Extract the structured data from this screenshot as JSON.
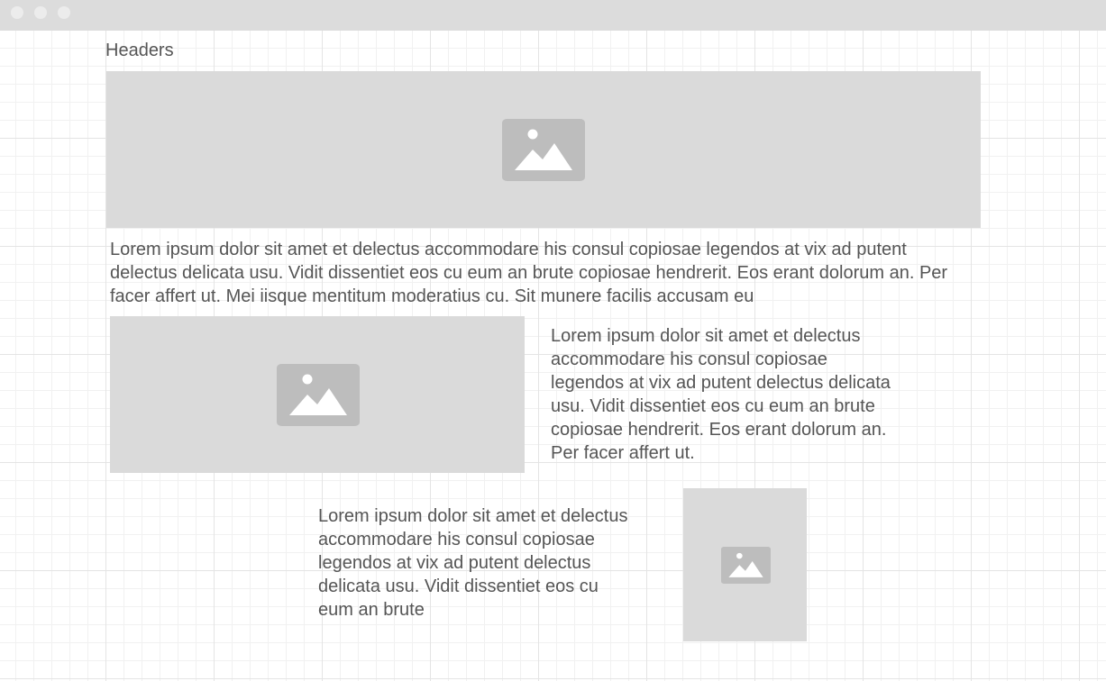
{
  "window": {
    "controls": [
      "close-dot",
      "minimize-dot",
      "maximize-dot"
    ]
  },
  "page": {
    "header": "Headers",
    "hero_image_icon": "image-placeholder-icon",
    "paragraph_1": "Lorem ipsum dolor sit amet et delectus accommodare his consul copiosae legendos at vix ad putent delectus delicata usu. Vidit dissentiet eos cu eum an brute copiosae hendrerit. Eos erant dolorum an. Per facer affert ut. Mei iisque mentitum moderatius cu. Sit munere facilis accusam eu",
    "media_left_image_icon": "image-placeholder-icon",
    "paragraph_2": "Lorem ipsum dolor sit amet et delectus accommodare his consul copiosae legendos at vix ad putent delectus delicata usu. Vidit dissentiet eos cu eum an brute copiosae hendrerit. Eos erant dolorum an. Per facer affert ut.",
    "paragraph_3": "Lorem ipsum dolor sit amet et delectus accommodare his consul copiosae legendos at vix ad putent delectus delicata usu. Vidit dissentiet eos cu eum an brute",
    "media_right_image_icon": "image-placeholder-icon"
  },
  "colors": {
    "titlebar": "#dcdcdc",
    "placeholder": "#dadada",
    "icon": "#bdbdbd",
    "text": "#555555",
    "grid_major": "#e4e4e4",
    "grid_minor": "#f1f1f1"
  }
}
